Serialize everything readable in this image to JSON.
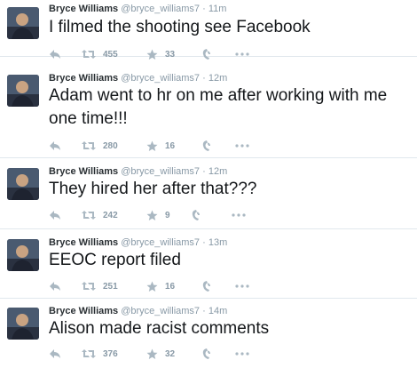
{
  "tweets": [
    {
      "name": "Bryce Williams",
      "handle": "@bryce_williams7",
      "dot": "·",
      "time": "11m",
      "text": "I filmed the shooting see Facebook",
      "retweets": "455",
      "favorites": "33"
    },
    {
      "name": "Bryce Williams",
      "handle": "@bryce_williams7",
      "dot": "·",
      "time": "12m",
      "text": "Adam went to hr on me after working with me one time!!!",
      "retweets": "280",
      "favorites": "16"
    },
    {
      "name": "Bryce Williams",
      "handle": "@bryce_williams7",
      "dot": "·",
      "time": "12m",
      "text": "They hired her after that???",
      "retweets": "242",
      "favorites": "9"
    },
    {
      "name": "Bryce Williams",
      "handle": "@bryce_williams7",
      "dot": "·",
      "time": "13m",
      "text": "EEOC report filed",
      "retweets": "251",
      "favorites": "16"
    },
    {
      "name": "Bryce Williams",
      "handle": "@bryce_williams7",
      "dot": "·",
      "time": "14m",
      "text": "Alison made racist comments",
      "retweets": "376",
      "favorites": "32"
    }
  ],
  "icons": {
    "reply": "reply-icon",
    "retweet": "retweet-icon",
    "favorite": "star-icon",
    "vine": "vine-icon",
    "more": "more-icon"
  },
  "colors": {
    "icon": "#aab8c2",
    "meta": "#8899a6",
    "divider": "#e1e8ed"
  }
}
